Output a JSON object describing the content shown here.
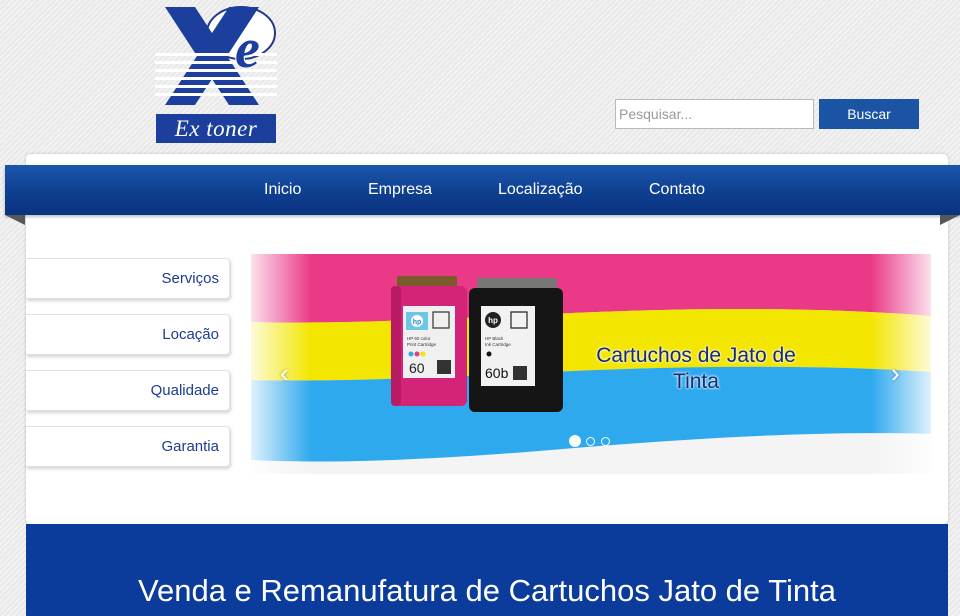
{
  "brand": {
    "logo_text": "Ex toner"
  },
  "search": {
    "placeholder": "Pesquisar...",
    "button_label": "Buscar"
  },
  "nav": {
    "items": [
      "Inicio",
      "Empresa",
      "Localização",
      "Contato"
    ]
  },
  "sidebar": {
    "items": [
      "Serviços",
      "Locação",
      "Qualidade",
      "Garantia"
    ]
  },
  "slider": {
    "caption": "Cartuchos de Jato de Tinta",
    "prev_arrow": "‹",
    "next_arrow": "›",
    "dots": 3,
    "active_dot": 1,
    "cartridges": {
      "color": {
        "label": "HP 60",
        "brand": "hp",
        "line1": "HP 60 color",
        "line2": "Print Cartridge"
      },
      "black": {
        "label": "60b",
        "brand": "hp",
        "line1": "HP Black",
        "line2": "Ink Cartridge"
      }
    }
  },
  "banner": {
    "title": "Venda e Remanufatura de Cartuchos Jato de Tinta"
  },
  "colors": {
    "nav_blue": "#0f3f8f",
    "button_blue": "#1b54a3",
    "banner_blue": "#0b3c9b",
    "sidebar_text": "#1d3c8f",
    "stripe_magenta": "#ea3a87",
    "stripe_yellow": "#f3e600",
    "stripe_cyan": "#2ea9ee"
  }
}
